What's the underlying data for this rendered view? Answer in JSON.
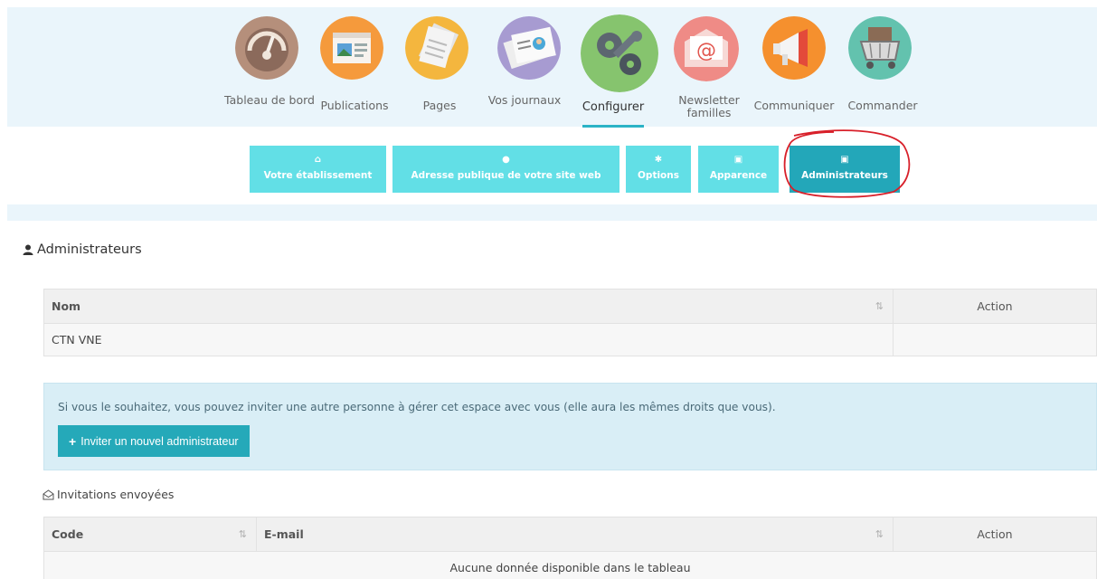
{
  "nav": {
    "items": [
      {
        "label": "Tableau de bord",
        "icon": "dashboard-gauge-icon"
      },
      {
        "label": "Publications",
        "icon": "publications-icon"
      },
      {
        "label": "Pages",
        "icon": "pages-icon"
      },
      {
        "label": "Vos journaux",
        "icon": "newspaper-icon"
      },
      {
        "label": "Configurer",
        "icon": "gears-icon",
        "active": true
      },
      {
        "label": "Newsletter familles",
        "icon": "email-icon"
      },
      {
        "label": "Communiquer",
        "icon": "megaphone-icon"
      },
      {
        "label": "Commander",
        "icon": "shopping-cart-icon"
      }
    ]
  },
  "tabs": [
    {
      "label": "Votre établissement",
      "icon": "home-icon"
    },
    {
      "label": "Adresse publique de votre site web",
      "icon": "globe-icon"
    },
    {
      "label": "Options",
      "icon": "gear-icon"
    },
    {
      "label": "Apparence",
      "icon": "image-icon"
    },
    {
      "label": "Administrateurs",
      "icon": "image-icon",
      "active": true
    }
  ],
  "section_title": "Administrateurs",
  "admins_table": {
    "headers": [
      "Nom",
      "Action"
    ],
    "rows": [
      [
        "CTN VNE",
        ""
      ]
    ]
  },
  "invite_box": {
    "text": "Si vous le souhaitez, vous pouvez inviter une autre personne à gérer cet espace avec vous (elle aura les mêmes droits que vous).",
    "button": "Inviter un nouvel administrateur"
  },
  "invitations": {
    "title": "Invitations envoyées",
    "headers": [
      "Code",
      "E-mail",
      "Action"
    ],
    "empty": "Aucune donnée disponible dans le tableau"
  },
  "colors": {
    "accent": "#23a7b9",
    "tab": "#62dfe6",
    "annotation": "#d8202a"
  }
}
